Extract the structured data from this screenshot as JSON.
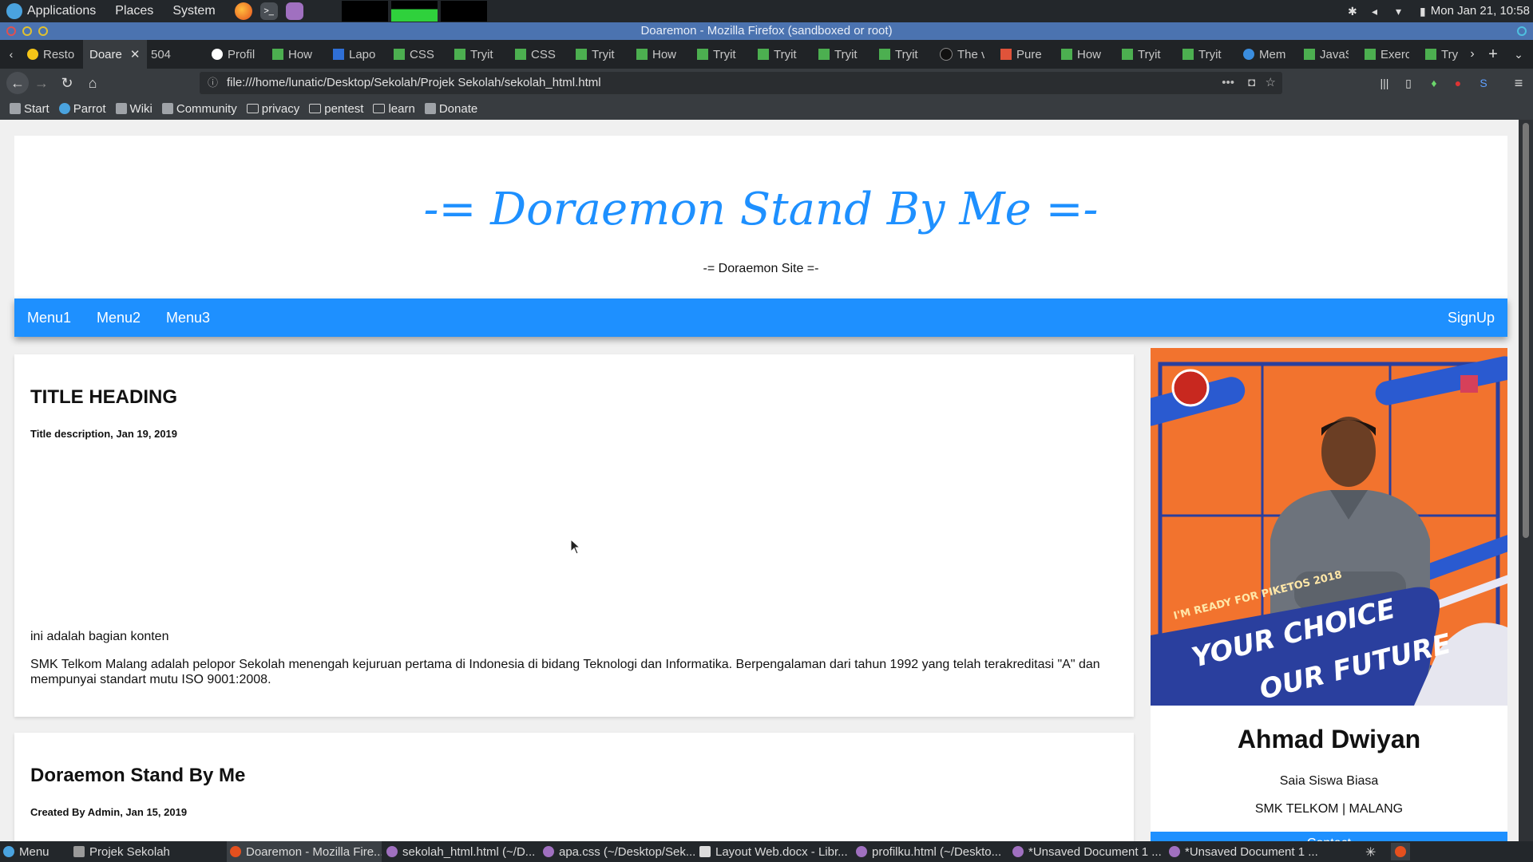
{
  "os_panel": {
    "menus": [
      "Applications",
      "Places",
      "System"
    ],
    "clock": "Mon Jan 21, 10:58"
  },
  "firefox": {
    "window_title": "Doaremon - Mozilla Firefox (sandboxed or root)",
    "tabs": [
      {
        "label": "Resto",
        "icon": "yellow-dot-icon"
      },
      {
        "label": "Doare",
        "icon": "none",
        "active": true
      },
      {
        "label": "504",
        "icon": "none"
      },
      {
        "label": "Profil",
        "icon": "google-icon"
      },
      {
        "label": "How",
        "icon": "w3schools-icon"
      },
      {
        "label": "Lapo",
        "icon": "blue-square-icon"
      },
      {
        "label": "CSS",
        "icon": "w3schools-icon"
      },
      {
        "label": "Tryit",
        "icon": "w3schools-icon"
      },
      {
        "label": "CSS",
        "icon": "w3schools-icon"
      },
      {
        "label": "Tryit",
        "icon": "w3schools-icon"
      },
      {
        "label": "How",
        "icon": "w3schools-icon"
      },
      {
        "label": "Tryit",
        "icon": "w3schools-icon"
      },
      {
        "label": "Tryit",
        "icon": "w3schools-icon"
      },
      {
        "label": "Tryit",
        "icon": "w3schools-icon"
      },
      {
        "label": "Tryit",
        "icon": "w3schools-icon"
      },
      {
        "label": "The v",
        "icon": "github-icon"
      },
      {
        "label": "Pure",
        "icon": "pure-icon"
      },
      {
        "label": "How",
        "icon": "w3schools-icon"
      },
      {
        "label": "Tryit",
        "icon": "w3schools-icon"
      },
      {
        "label": "Tryit",
        "icon": "w3schools-icon"
      },
      {
        "label": "Mem",
        "icon": "slash-icon"
      },
      {
        "label": "JavaS",
        "icon": "w3schools-icon"
      },
      {
        "label": "Exerc",
        "icon": "w3schools-icon"
      },
      {
        "label": "Try",
        "icon": "w3schools-icon"
      }
    ],
    "url": "file:///home/lunatic/Desktop/Sekolah/Projek Sekolah/sekolah_html.html",
    "bookmarks": [
      {
        "label": "Start",
        "icon": "start-icon"
      },
      {
        "label": "Parrot",
        "icon": "parrot-icon"
      },
      {
        "label": "Wiki",
        "icon": "wiki-icon"
      },
      {
        "label": "Community",
        "icon": "community-icon"
      },
      {
        "label": "privacy",
        "icon": "folder-icon"
      },
      {
        "label": "pentest",
        "icon": "folder-icon"
      },
      {
        "label": "learn",
        "icon": "folder-icon"
      },
      {
        "label": "Donate",
        "icon": "donate-icon"
      }
    ]
  },
  "site": {
    "title": "-= Doraemon Stand By Me =-",
    "subtitle": "-= Doraemon Site =-",
    "nav": [
      "Menu1",
      "Menu2",
      "Menu3"
    ],
    "signup": "SignUp",
    "posts": [
      {
        "heading": "TITLE HEADING",
        "meta": "Title description, Jan 19, 2019",
        "body_intro": "ini adalah bagian konten",
        "body": "SMK Telkom Malang adalah pelopor Sekolah menengah kejuruan pertama di Indonesia di bidang Teknologi dan Informatika. Berpengalaman dari tahun 1992 yang telah terakreditasi \"A\" dan mempunyai standart mutu ISO 9001:2008."
      },
      {
        "heading": "Doraemon Stand By Me",
        "meta": "Created By Admin, Jan 15, 2019"
      }
    ],
    "profile": {
      "poster_top": "I'M READY FOR PIKETOS 2018",
      "poster_line1": "YOUR CHOICE",
      "poster_line2": "OUR FUTURE",
      "name": "Ahmad Dwiyan",
      "role": "Saia Siswa Biasa",
      "school": "SMK TELKOM | MALANG",
      "contact_label": "Contact"
    }
  },
  "taskbar": {
    "menu": "Menu",
    "items": [
      {
        "label": "Projek Sekolah",
        "icon": "folder-icon"
      },
      {
        "label": "Doaremon - Mozilla Fire...",
        "icon": "firefox-icon",
        "active": true
      },
      {
        "label": "sekolah_html.html (~/D...",
        "icon": "editor-icon"
      },
      {
        "label": "apa.css (~/Desktop/Sek...",
        "icon": "editor-icon"
      },
      {
        "label": "Layout Web.docx - Libr...",
        "icon": "writer-icon"
      },
      {
        "label": "profilku.html (~/Deskto...",
        "icon": "editor-icon"
      },
      {
        "label": "*Unsaved Document 1 ...",
        "icon": "editor-icon"
      },
      {
        "label": "*Unsaved Document 1 ...",
        "icon": "editor-icon"
      }
    ]
  },
  "colors": {
    "brand": "#1e90ff",
    "poster_orange": "#f2732e",
    "poster_navy": "#2a3f9e",
    "os_panel": "#23272b"
  }
}
